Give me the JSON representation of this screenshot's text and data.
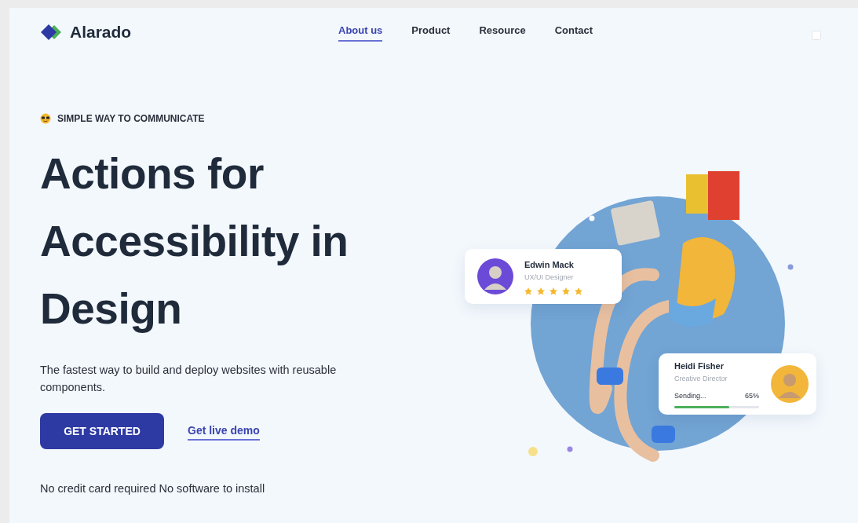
{
  "brand": {
    "name": "Alarado"
  },
  "nav": [
    {
      "label": "About us",
      "selected": true
    },
    {
      "label": "Product",
      "selected": false
    },
    {
      "label": "Resource",
      "selected": false
    },
    {
      "label": "Contact",
      "selected": false
    }
  ],
  "hero": {
    "eyebrow": "SIMPLE WAY TO COMMUNICATE",
    "title": "Actions for Accessibility in Design",
    "subtitle": "The fastest way to build and deploy websites with reusable components.",
    "primary_button": "GET STARTED",
    "secondary_link": "Get live demo",
    "note": "No credit card required No software to install"
  },
  "profile_card": {
    "name": "Edwin Mack",
    "role": "UX/UI Designer",
    "stars": 5
  },
  "status_card": {
    "name": "Heidi Fisher",
    "role": "Creative Director",
    "label": "Sending...",
    "reading": "65%",
    "level": 0.65
  }
}
